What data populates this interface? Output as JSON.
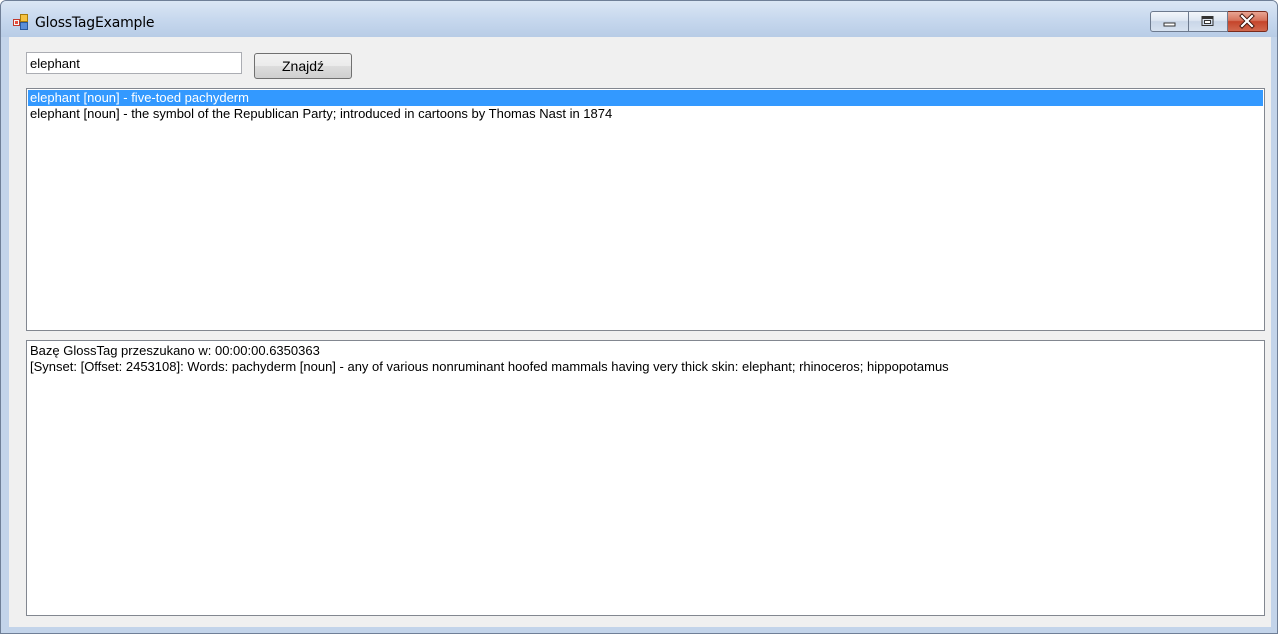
{
  "window": {
    "title": "GlossTagExample",
    "icon": "app-icon"
  },
  "search": {
    "value": "elephant"
  },
  "find_button": {
    "label": "Znajdź"
  },
  "results": [
    {
      "text": "elephant [noun] -  five-toed pachyderm",
      "selected": true
    },
    {
      "text": "elephant [noun] -  the symbol of the Republican Party; introduced in cartoons by Thomas Nast in 1874",
      "selected": false
    }
  ],
  "output": {
    "lines": [
      "Bazę GlossTag przeszukano w: 00:00:00.6350363",
      "[Synset: [Offset: 2453108]: Words: pachyderm [noun] -  any of various nonruminant hoofed mammals having very thick skin: elephant; rhinoceros; hippopotamus"
    ]
  },
  "colors": {
    "selection": "#3399ff",
    "client_bg": "#f0f0f0",
    "close_button": "#c5442a"
  }
}
